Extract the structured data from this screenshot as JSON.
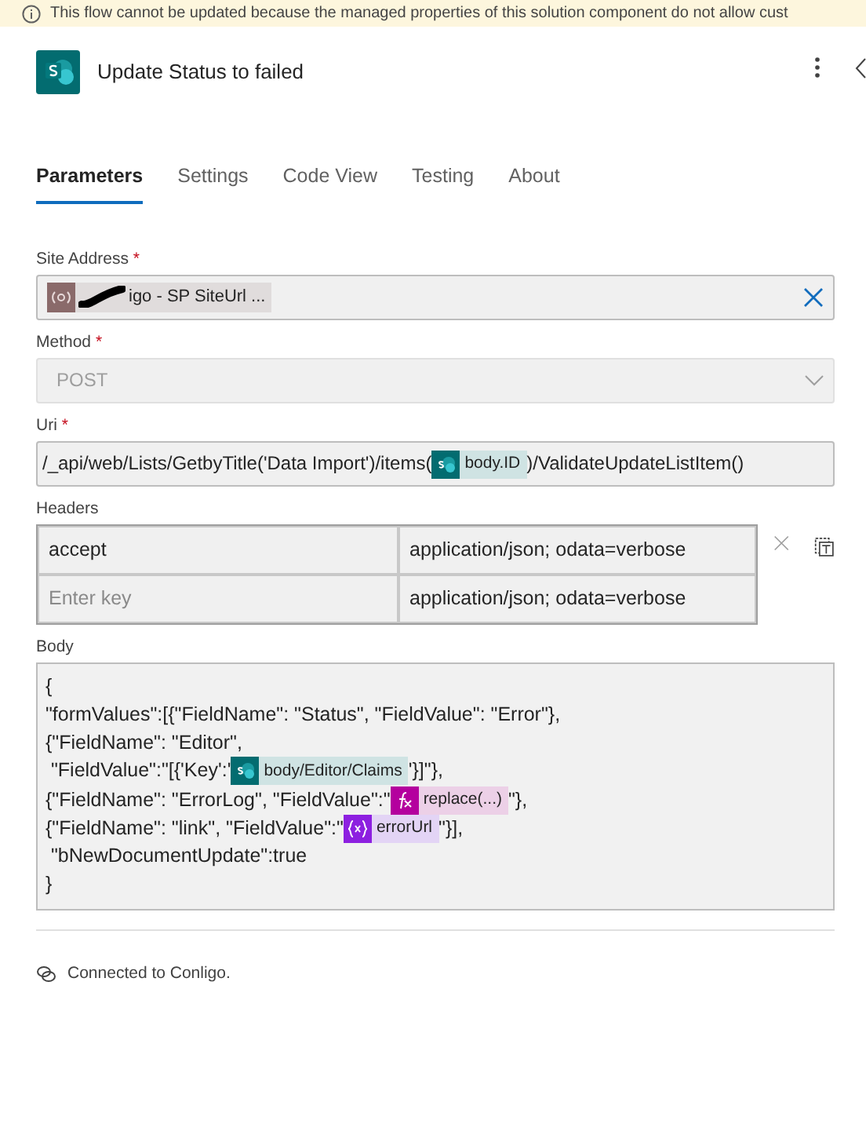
{
  "banner": {
    "text": "This flow cannot be updated because the managed properties of this solution component do not allow cust"
  },
  "header": {
    "title": "Update Status to failed"
  },
  "tabs": [
    {
      "label": "Parameters",
      "selected": true
    },
    {
      "label": "Settings",
      "selected": false
    },
    {
      "label": "Code View",
      "selected": false
    },
    {
      "label": "Testing",
      "selected": false
    },
    {
      "label": "About",
      "selected": false
    }
  ],
  "site_address": {
    "label": "Site Address",
    "required_mark": "*",
    "chip": "igo - SP SiteUrl ...",
    "redacted": true
  },
  "method": {
    "label": "Method",
    "required_mark": "*",
    "value": "POST",
    "disabled": true
  },
  "uri": {
    "label": "Uri",
    "required_mark": "*",
    "segments": [
      {
        "kind": "text",
        "text": "/_api/web/Lists/GetbyTitle('Data Import')/items("
      },
      {
        "kind": "sharepoint",
        "text": "body.ID"
      },
      {
        "kind": "text",
        "text": ")/ValidateUpdateListItem()"
      }
    ]
  },
  "headers": {
    "label": "Headers",
    "rows": [
      {
        "key": "accept",
        "value": "application/json; odata=verbose"
      },
      {
        "placeholder": "Enter key",
        "value": "application/json; odata=verbose"
      }
    ]
  },
  "body": {
    "label": "Body",
    "lines": [
      [
        {
          "kind": "text",
          "text": "{"
        }
      ],
      [
        {
          "kind": "text",
          "text": "\"formValues\":[{\"FieldName\": \"Status\", \"FieldValue\": \"Error\"},"
        }
      ],
      [
        {
          "kind": "text",
          "text": "{\"FieldName\": \"Editor\","
        }
      ],
      [
        {
          "kind": "text",
          "text": " \"FieldValue\":\"[{'Key':'"
        },
        {
          "kind": "sharepoint",
          "text": "body/Editor/Claims"
        },
        {
          "kind": "text",
          "text": "'}]\"},"
        }
      ],
      [
        {
          "kind": "text",
          "text": "{\"FieldName\": \"ErrorLog\", \"FieldValue\":\""
        },
        {
          "kind": "function",
          "text": "replace(...)"
        },
        {
          "kind": "text",
          "text": "\"},"
        }
      ],
      [
        {
          "kind": "text",
          "text": "{\"FieldName\": \"link\", \"FieldValue\":\""
        },
        {
          "kind": "variable",
          "text": "errorUrl"
        },
        {
          "kind": "text",
          "text": "\"}],"
        }
      ],
      [
        {
          "kind": "text",
          "text": " \"bNewDocumentUpdate\":true"
        }
      ],
      [
        {
          "kind": "text",
          "text": "}"
        }
      ]
    ]
  },
  "footer": {
    "text": "Connected to Conligo."
  }
}
